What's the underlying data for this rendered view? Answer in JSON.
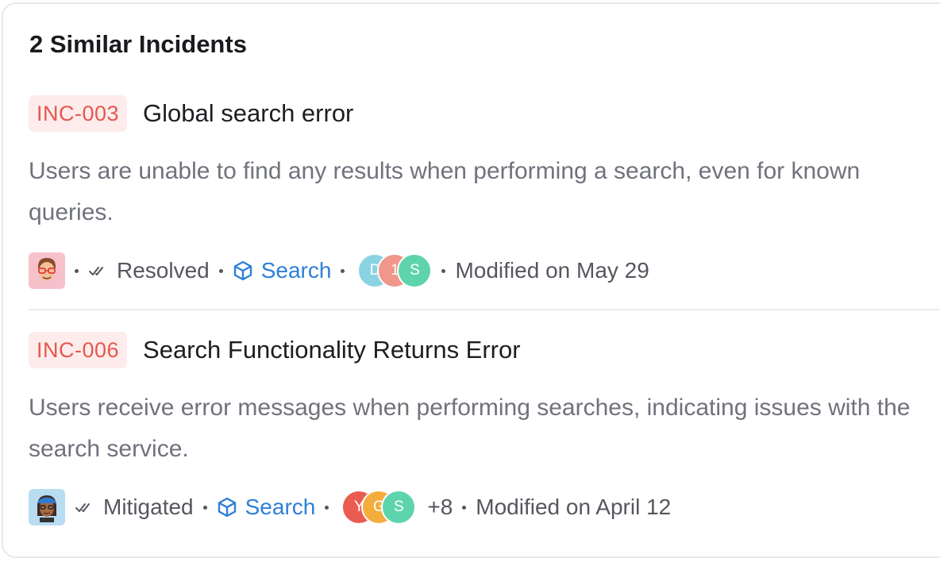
{
  "panel": {
    "heading": "2 Similar Incidents"
  },
  "incidents": [
    {
      "id": "INC-003",
      "title": "Global search error",
      "description_line1": "Users are unable to find any results when performing a search, even for known",
      "description_line2": "queries.",
      "status": "Resolved",
      "service": "Search",
      "people": [
        {
          "initial": "D",
          "color": "#8ad3e3"
        },
        {
          "initial": "1",
          "color": "#f0968a"
        },
        {
          "initial": "S",
          "color": "#5ed4ad"
        }
      ],
      "extra_count": "",
      "modified": "Modified on May 29"
    },
    {
      "id": "INC-006",
      "title": "Search Functionality Returns Error",
      "description_line1": "Users receive error messages when performing searches, indicating issues with the",
      "description_line2": "search service.",
      "status": "Mitigated",
      "service": "Search",
      "people": [
        {
          "initial": "Y",
          "color": "#ea5b50"
        },
        {
          "initial": "G",
          "color": "#f4ad3d"
        },
        {
          "initial": "S",
          "color": "#5ed4ad"
        }
      ],
      "extra_count": "+8",
      "modified": "Modified on April 12"
    }
  ],
  "colors": {
    "id_badge_bg": "#fdeceb",
    "id_badge_text": "#e4584e",
    "service_link": "#2d7fd8"
  },
  "icons": {
    "status": "double-check-icon",
    "service": "cube-icon"
  }
}
